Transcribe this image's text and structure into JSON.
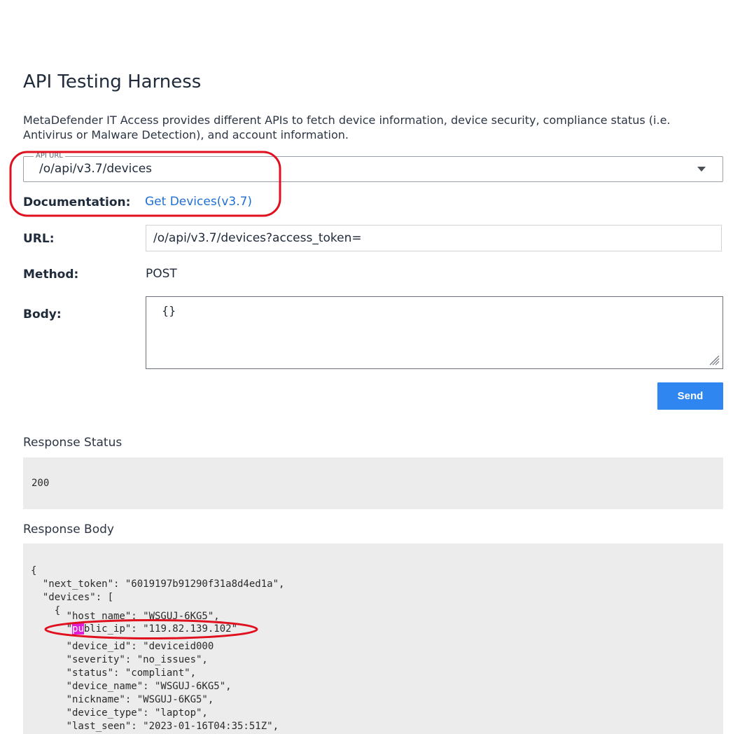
{
  "page": {
    "title": "API Testing Harness",
    "intro": "MetaDefender IT Access provides different APIs to fetch device information, device security, compliance status (i.e. Antivirus or Malware Detection), and account information."
  },
  "api_url": {
    "legend": "API URL",
    "selected": "/o/api/v3.7/devices"
  },
  "documentation": {
    "label": "Documentation:",
    "link_text": "Get Devices(v3.7)"
  },
  "url": {
    "label": "URL:",
    "value": "/o/api/v3.7/devices?access_token="
  },
  "method": {
    "label": "Method:",
    "value": "POST"
  },
  "body": {
    "label": "Body:",
    "value": "{}"
  },
  "send_button": "Send",
  "response_status": {
    "heading": "Response Status",
    "code": "200"
  },
  "response_body": {
    "heading": "Response Body",
    "lines": [
      "{",
      "  \"next_token\": \"6019197b91290f31a8d4ed1a\",",
      "  \"devices\": [",
      "    {",
      "      \"host_name\": \"WSGUJ-6KG5\",",
      "      \"public_ip\": \"119.82.139.102\"",
      "      \"device_id\": \"deviceid000",
      "      \"severity\": \"no_issues\",",
      "      \"status\": \"compliant\",",
      "      \"device_name\": \"WSGUJ-6KG5\",",
      "      \"nickname\": \"WSGUJ-6KG5\",",
      "      \"device_type\": \"laptop\",",
      "      \"last_seen\": \"2023-01-16T04:35:51Z\","
    ],
    "highlight_line_prefix": "      \"",
    "highlight_text": "pu",
    "highlight_line_suffix": "blic_ip\": \"119.82.139.102\""
  },
  "colors": {
    "accent": "#2f86f0",
    "link": "#1f6fd6",
    "annotation": "#e0101e",
    "highlight": "#e01ed8"
  }
}
